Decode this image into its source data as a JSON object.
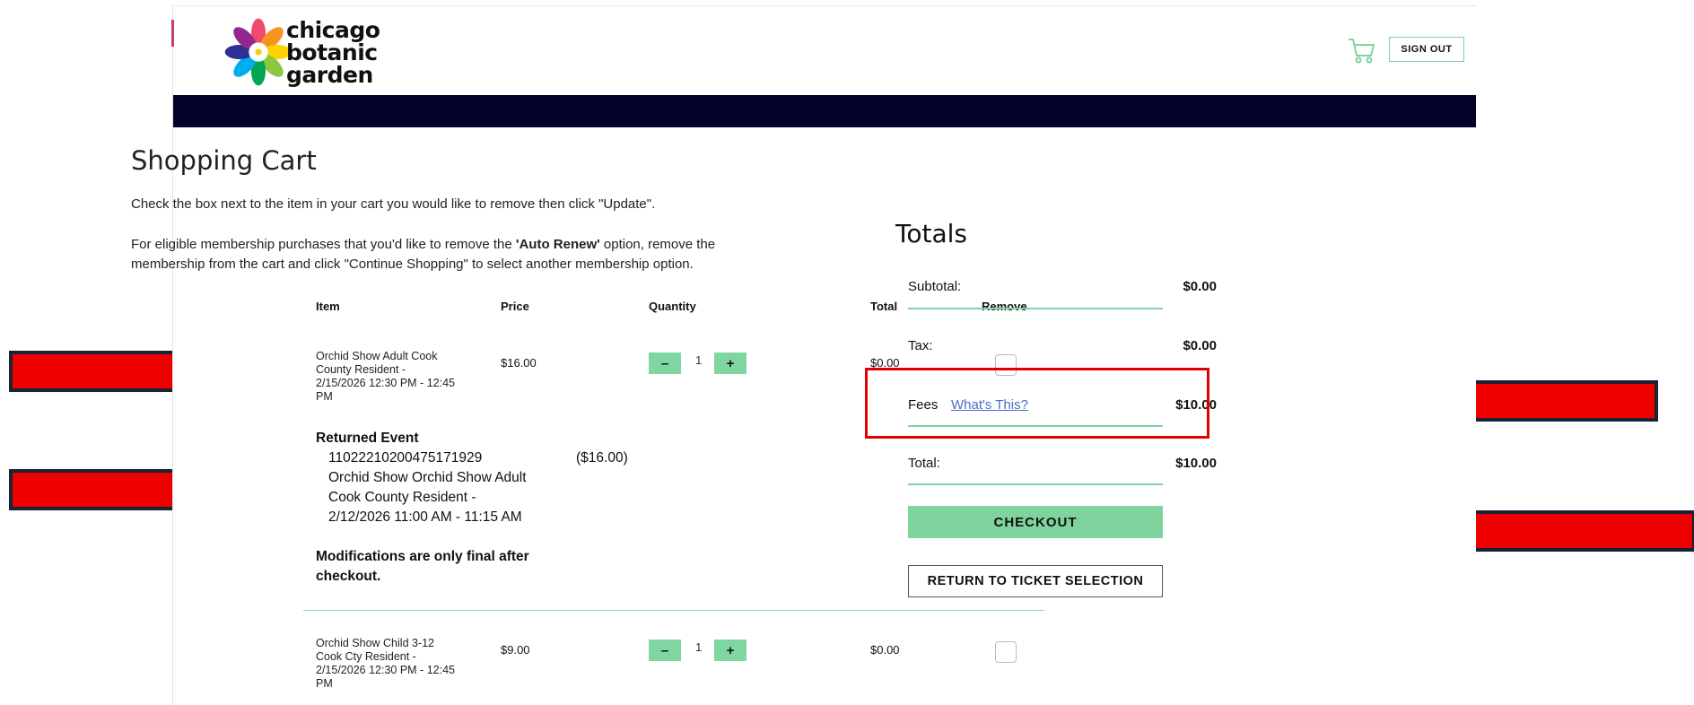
{
  "header": {
    "logo_lines": [
      "chicago",
      "botanic",
      "garden"
    ],
    "sign_out_label": "SIGN OUT",
    "cart_icon": "shopping-cart-icon"
  },
  "cart": {
    "title": "Shopping Cart",
    "instruction": "Check the box next to the item in your cart you would like to remove then click \"Update\".",
    "auto_renew_before": "For eligible membership purchases that you'd like to remove the ",
    "auto_renew_bold": "'Auto Renew'",
    "auto_renew_after_line1": " option, remove the",
    "auto_renew_line2": "membership from the cart and click \"Continue Shopping\" to select another membership option.",
    "columns": {
      "item": "Item",
      "price": "Price",
      "quantity": "Quantity",
      "total": "Total",
      "remove": "Remove"
    },
    "items": [
      {
        "name_lines": [
          "Orchid Show Adult Cook",
          "County Resident   -",
          "2/15/2026 12:30 PM - 12:45",
          "PM"
        ],
        "price": "$16.00",
        "quantity": "1",
        "total": "$0.00"
      },
      {
        "name_lines": [
          "Orchid Show Child 3-12",
          "Cook Cty Resident   -",
          "2/15/2026 12:30 PM - 12:45",
          "PM"
        ],
        "price": "$9.00",
        "quantity": "1",
        "total": "$0.00"
      }
    ],
    "returned": {
      "heading": "Returned Event",
      "lines": [
        "11022210200475171929",
        "Orchid Show Orchid Show Adult",
        "Cook County Resident   -",
        "2/12/2026 11:00 AM - 11:15 AM"
      ],
      "amount": "($16.00)",
      "note_lines": [
        "Modifications are only final after",
        "checkout."
      ]
    },
    "qty_minus": "–",
    "qty_plus": "+"
  },
  "totals": {
    "title": "Totals",
    "subtotal_label": "Subtotal:",
    "subtotal_value": "$0.00",
    "tax_label": "Tax:",
    "tax_value": "$0.00",
    "fees_label": "Fees",
    "fees_link": "What's This?",
    "fees_value": "$10.00",
    "total_label": "Total:",
    "total_value": "$10.00",
    "checkout_label": "CHECKOUT",
    "return_label": "RETURN TO TICKET SELECTION"
  },
  "colors": {
    "accent_green": "#7fd49d",
    "nav_dark": "#02022a",
    "annotation_red": "#e00000"
  }
}
